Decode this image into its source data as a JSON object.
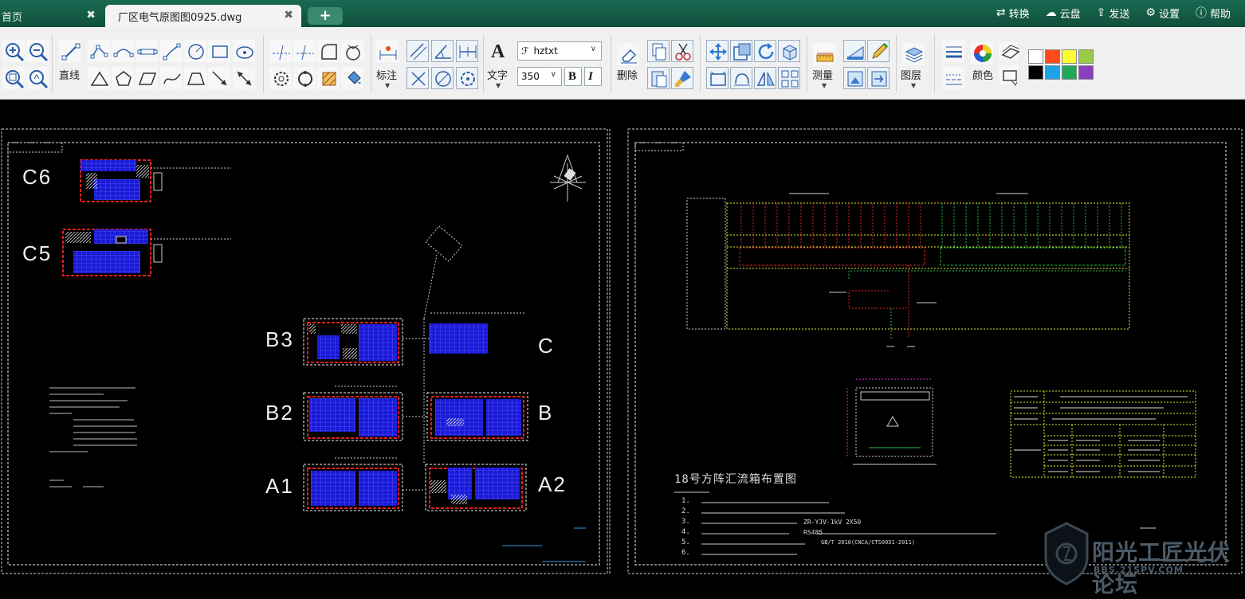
{
  "tabs": {
    "home": "首页",
    "active": "厂区电气原图图0925.dwg",
    "close_glyph": "✖",
    "add_glyph": "+"
  },
  "top_menu": [
    {
      "icon": "convert-icon",
      "label": "转换"
    },
    {
      "icon": "cloud-icon",
      "label": "云盘"
    },
    {
      "icon": "send-icon",
      "label": "发送"
    },
    {
      "icon": "gear-icon",
      "label": "设置"
    },
    {
      "icon": "help-icon",
      "label": "帮助"
    }
  ],
  "toolbar": {
    "line_label": "直线",
    "dimension_label": "标注",
    "text_label": "文字",
    "delete_label": "删除",
    "measure_label": "测量",
    "layer_label": "图层",
    "color_label": "颜色",
    "font_value": "hztxt",
    "size_value": "350",
    "bold": "B",
    "italic": "I",
    "text_icon_glyph": "A",
    "palette": [
      "#ffffff",
      "#ff4a1a",
      "#ffff33",
      "#99cc44",
      "#000000",
      "#1aa3e8",
      "#1fa85a",
      "#8a3fbf"
    ]
  },
  "drawing": {
    "left_sheet": {
      "sections": [
        "C6",
        "C5",
        "B3",
        "B2",
        "A1",
        "C",
        "B",
        "A2"
      ]
    },
    "right_sheet": {
      "caption_bottom": "18号方阵汇流箱布置图",
      "numbered_notes": [
        "1.",
        "2.",
        "3.",
        "4.",
        "5.",
        "6."
      ],
      "partial_text": [
        "ZR-YJV-1kV 2X50",
        "RS485",
        "GB/T 2010(CNCA/CTS0031-2011)"
      ]
    },
    "watermark": {
      "text": "阳光工匠光伏论坛",
      "url": "BBS.21SPV.COM"
    }
  }
}
